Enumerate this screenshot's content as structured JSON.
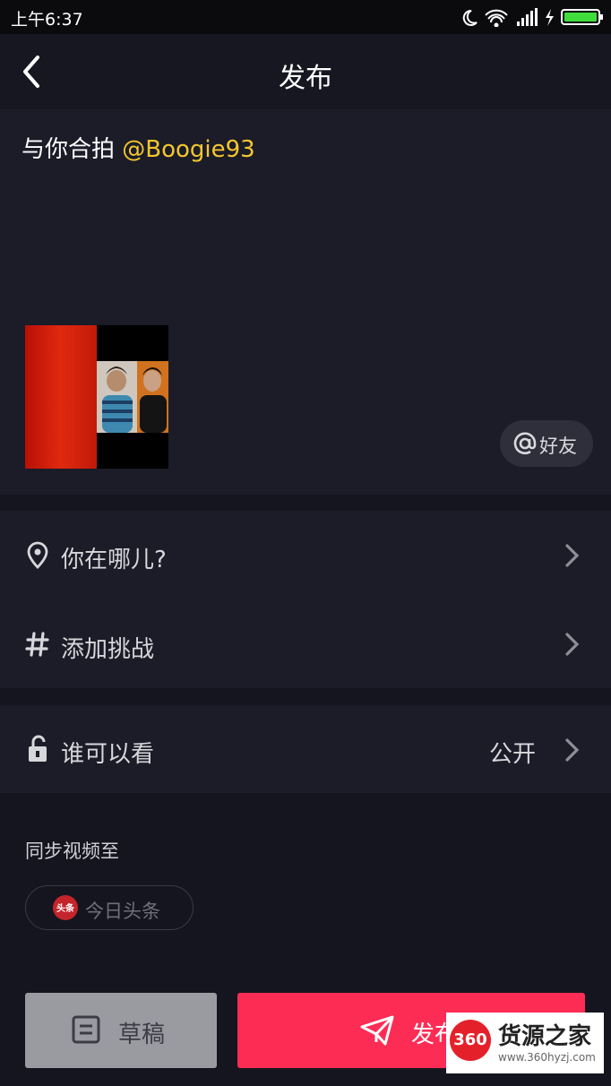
{
  "status_bar": {
    "time": "上午6:37"
  },
  "header": {
    "title": "发布"
  },
  "caption": {
    "prefix": "与你合拍 ",
    "mention": "@Boogie93"
  },
  "at_friend": {
    "label": "好友"
  },
  "location_row": {
    "label": "你在哪儿?"
  },
  "challenge_row": {
    "label": "添加挑战"
  },
  "privacy_row": {
    "label": "谁可以看",
    "value": "公开"
  },
  "sync": {
    "title": "同步视频至",
    "chip_label": "今日头条",
    "chip_logo": "头条"
  },
  "buttons": {
    "draft": "草稿",
    "publish": "发布"
  },
  "watermark": {
    "badge": "360",
    "name": "货源之家",
    "url": "www.360hyzj.com"
  },
  "colors": {
    "accent": "#fc2c55",
    "mention": "#f5c62f",
    "background": "#15151f"
  }
}
